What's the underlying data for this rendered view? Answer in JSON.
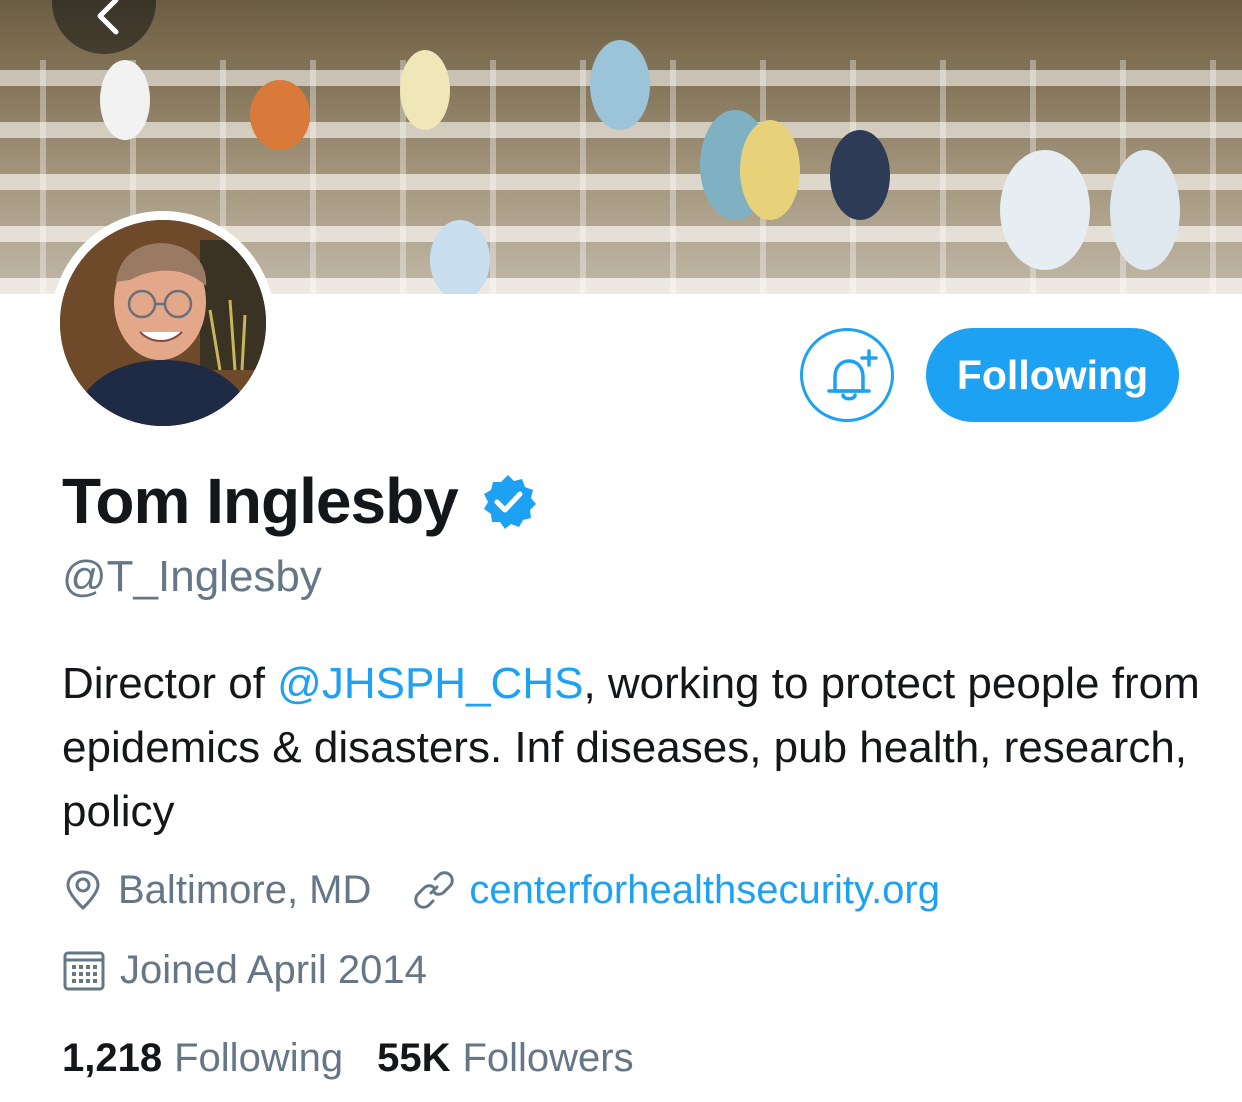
{
  "header": {
    "back_icon": "chevron-left-icon",
    "more_icon": "more-horizontal-icon"
  },
  "actions": {
    "notify_icon": "bell-plus-icon",
    "follow_label": "Following"
  },
  "profile": {
    "name": "Tom Inglesby",
    "verified_icon": "verified-badge-icon",
    "handle": "@T_Inglesby",
    "bio_prefix": "Director of ",
    "bio_mention": "@JHSPH_CHS",
    "bio_suffix": ", working to protect people from epidemics & disasters. Inf diseases, pub health, research, policy",
    "location": "Baltimore, MD",
    "website": "centerforhealthsecurity.org",
    "joined": "Joined April 2014",
    "following_count": "1,218",
    "following_label": "Following",
    "followers_count": "55K",
    "followers_label": "Followers"
  },
  "colors": {
    "accent": "#1da1f2",
    "text": "#14171a",
    "secondary": "#657786"
  }
}
